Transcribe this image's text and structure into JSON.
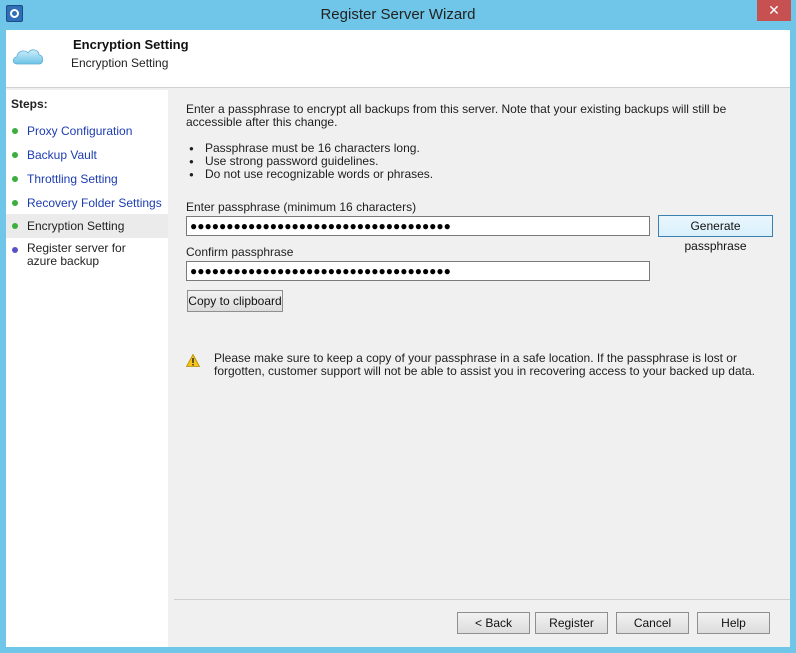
{
  "window": {
    "title": "Register Server Wizard",
    "close_label": "✕"
  },
  "header": {
    "title": "Encryption Setting",
    "subtitle": "Encryption Setting"
  },
  "sidebar": {
    "steps_label": "Steps:",
    "items": [
      {
        "label": "Proxy Configuration",
        "status": "complete"
      },
      {
        "label": "Backup Vault",
        "status": "complete"
      },
      {
        "label": "Throttling Setting",
        "status": "complete"
      },
      {
        "label": "Recovery Folder Settings",
        "status": "complete"
      },
      {
        "label": "Encryption Setting",
        "status": "current"
      },
      {
        "label": "Register server for azure backup",
        "status": "pending"
      }
    ]
  },
  "main": {
    "intro": "Enter a passphrase to encrypt all backups from this server. Note that your existing backups will still be accessible after this change.",
    "bullets": [
      "Passphrase must be 16 characters long.",
      "Use strong password guidelines.",
      "Do not use recognizable words or phrases."
    ],
    "passphrase_label": "Enter passphrase (minimum 16 characters)",
    "passphrase_value": "●●●●●●●●●●●●●●●●●●●●●●●●●●●●●●●●●●●●",
    "generate_label": "Generate passphrase",
    "confirm_label": "Confirm passphrase",
    "confirm_value": "●●●●●●●●●●●●●●●●●●●●●●●●●●●●●●●●●●●●",
    "copy_label": "Copy to clipboard",
    "warning": "Please make sure to keep a copy of your passphrase in a safe location. If the passphrase is lost or forgotten, customer support will not be able to assist you in recovering access to your backed up data."
  },
  "footer": {
    "back": "< Back",
    "register": "Register",
    "cancel": "Cancel",
    "help": "Help"
  },
  "colors": {
    "titlebar": "#6fc6e8",
    "link": "#1b3cb0",
    "complete_dot": "#3cae3c",
    "pending_dot": "#5a52c4"
  }
}
